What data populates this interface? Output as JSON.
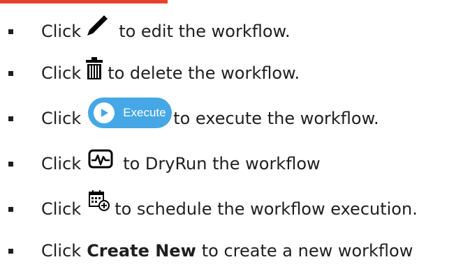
{
  "colors": {
    "accent_rule": "#e8412c",
    "execute_button": "#45a7e5",
    "text": "#1f1f1f"
  },
  "items": [
    {
      "prefix": "Click",
      "icon": "pencil-icon",
      "suffix": "to edit the workflow."
    },
    {
      "prefix": "Click",
      "icon": "trash-icon",
      "suffix": "to delete the workflow."
    },
    {
      "prefix": "Click",
      "icon": "execute-button",
      "button_label": "Execute",
      "suffix": "to execute the workflow."
    },
    {
      "prefix": "Click",
      "icon": "dryrun-monitor-icon",
      "suffix": "to DryRun the workflow"
    },
    {
      "prefix": "Click",
      "icon": "schedule-calendar-icon",
      "suffix": "to schedule the workflow execution."
    },
    {
      "prefix": "Click",
      "bold": "Create New",
      "suffix": "to create a new workflow"
    }
  ]
}
